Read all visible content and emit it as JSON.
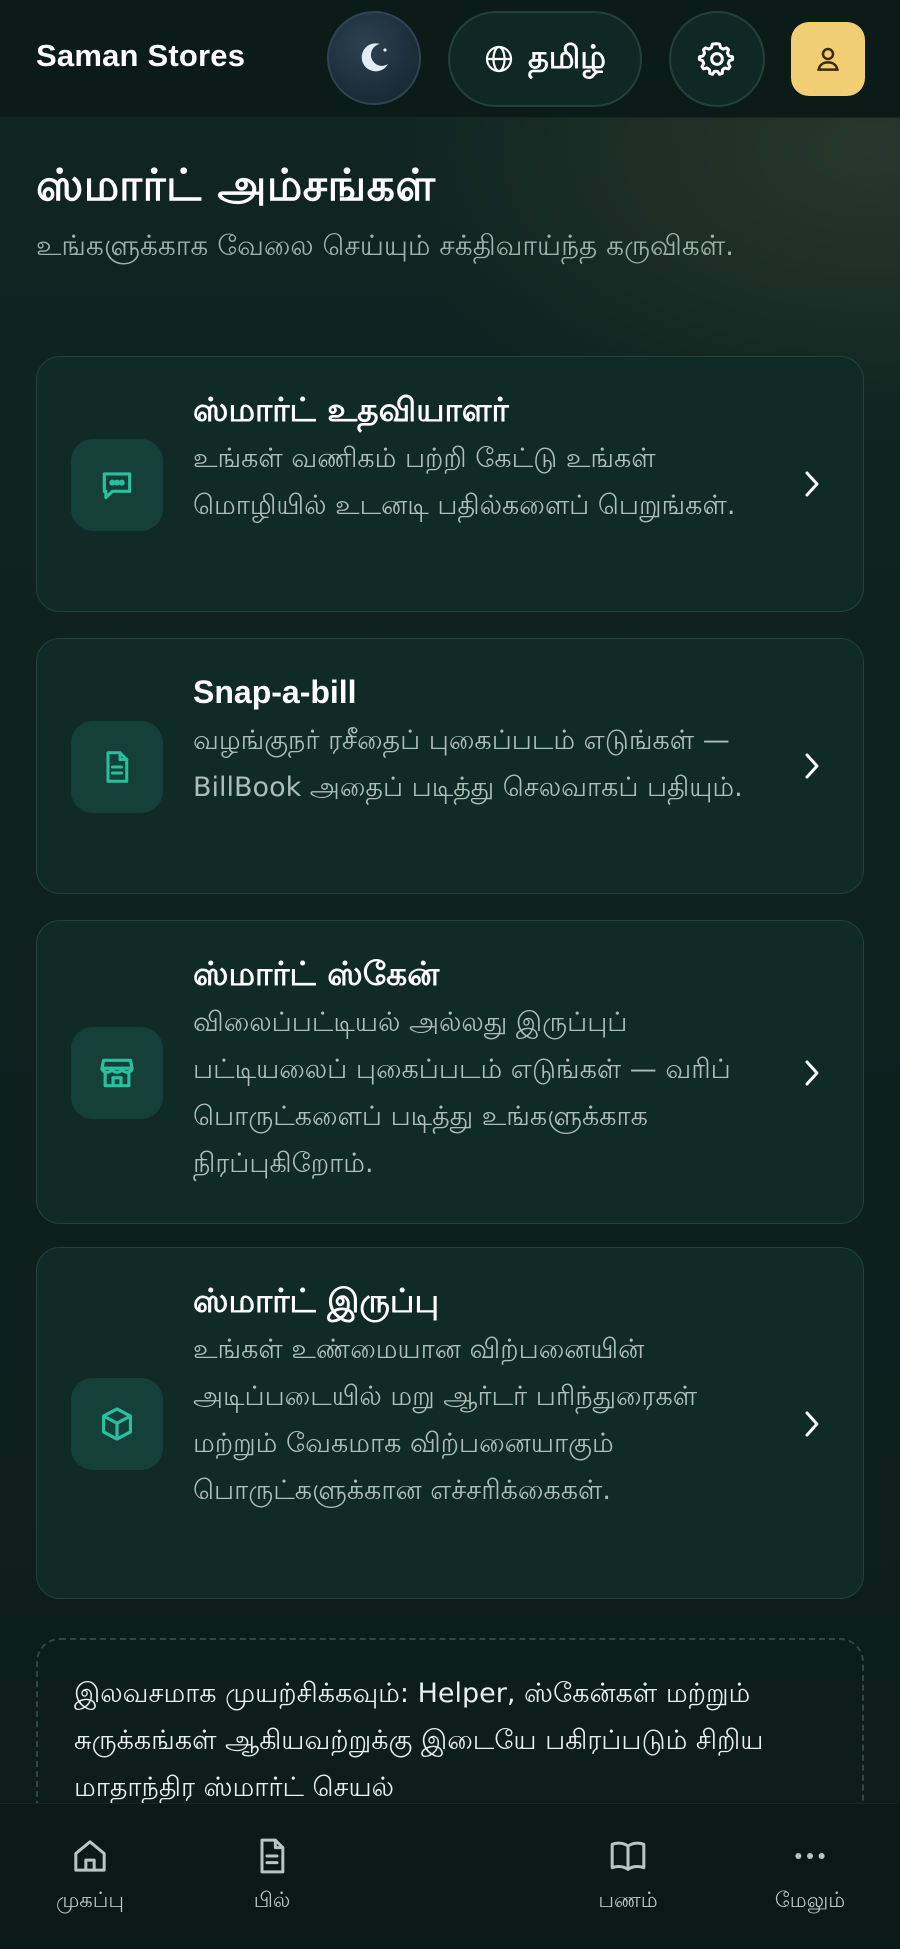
{
  "header": {
    "brand": "Saman Stores",
    "language_label": "தமிழ்",
    "icons": [
      "moon-icon",
      "globe-icon",
      "gear-icon",
      "user-icon"
    ]
  },
  "page": {
    "title": "ஸ்மார்ட் அம்சங்கள்",
    "subtitle": "உங்களுக்காக வேலை செய்யும் சக்திவாய்ந்த கருவிகள்."
  },
  "features": [
    {
      "title": "ஸ்மார்ட் உதவியாளர்",
      "description": "உங்கள் வணிகம் பற்றி கேட்டு உங்கள் மொழியில் உடனடி பதில்களைப் பெறுங்கள்.",
      "icon": "chat-icon"
    },
    {
      "title": "Snap-a-bill",
      "description": "வழங்குநர் ரசீதைப் புகைப்படம் எடுங்கள் — BillBook அதைப் படித்து செலவாகப் பதியும்.",
      "icon": "document-icon"
    },
    {
      "title": "ஸ்மார்ட் ஸ்கேன்",
      "description": "விலைப்பட்டியல் அல்லது இருப்புப் பட்டியலைப் புகைப்படம் எடுங்கள் — வரிப் பொருட்களைப் படித்து உங்களுக்காக நிரப்புகிறோம்.",
      "icon": "store-icon"
    },
    {
      "title": "ஸ்மார்ட் இருப்பு",
      "description": "உங்கள் உண்மையான விற்பனையின் அடிப்படையில் மறு ஆர்டர் பரிந்துரைகள் மற்றும் வேகமாக விற்பனையாகும் பொருட்களுக்கான எச்சரிக்கைகள்.",
      "icon": "box-icon"
    }
  ],
  "promo": {
    "text": "இலவசமாக முயற்சிக்கவும்: Helper, ஸ்கேன்கள் மற்றும் சுருக்கங்கள் ஆகியவற்றுக்கு இடையே பகிரப்படும் சிறிய மாதாந்திர ஸ்மார்ட் செயல்"
  },
  "bottom_nav": {
    "items": [
      {
        "label": "முகப்பு",
        "icon": "home-icon"
      },
      {
        "label": "பில்",
        "icon": "bill-icon"
      },
      {
        "label": "பணம்",
        "icon": "book-icon"
      },
      {
        "label": "மேலும்",
        "icon": "more-icon"
      }
    ]
  },
  "colors": {
    "accent": "#2bbf9e",
    "profile": "#f1cd74",
    "background": "#0e211d",
    "card": "#102a26"
  }
}
